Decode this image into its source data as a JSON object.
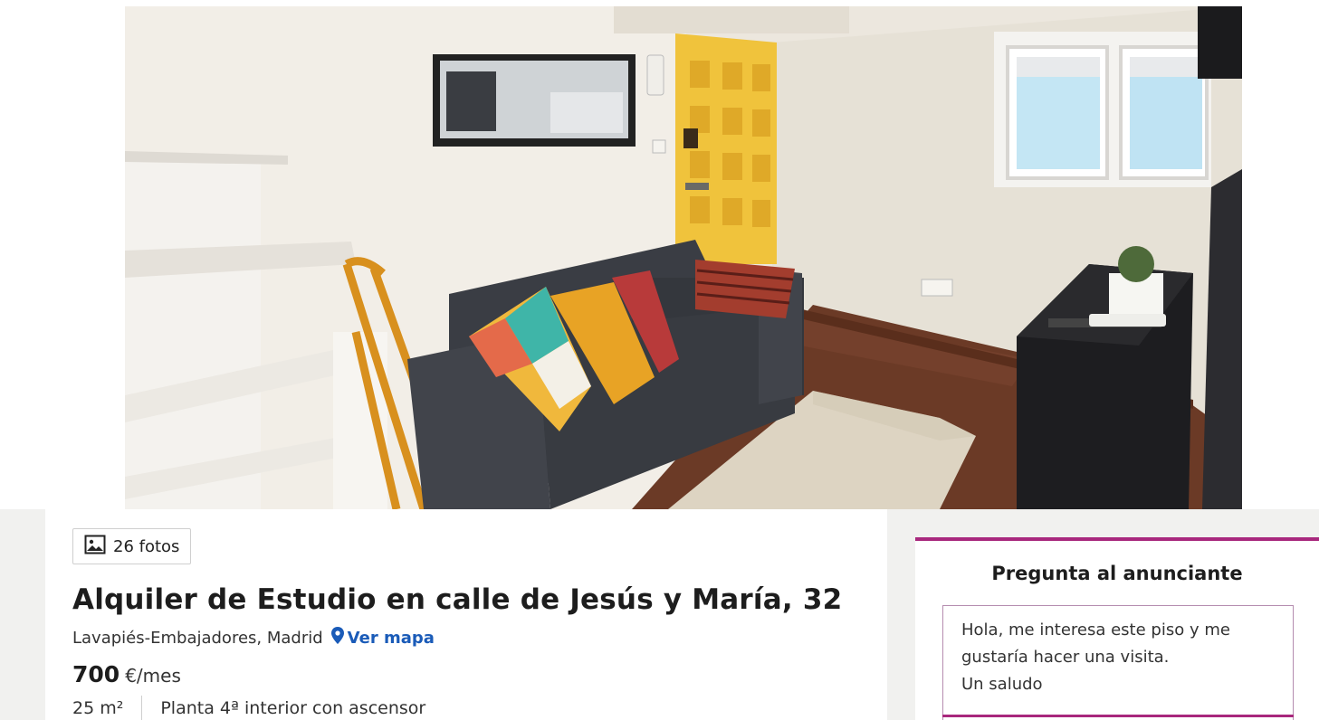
{
  "photos_button": {
    "icon": "image-icon",
    "label": "26 fotos"
  },
  "listing": {
    "title": "Alquiler de Estudio en calle de Jesús y María, 32",
    "location": "Lavapiés-Embajadores, Madrid",
    "map_link": {
      "icon": "map-pin-icon",
      "label": "Ver mapa"
    },
    "price": {
      "amount": "700",
      "unit": "€/mes"
    },
    "features": [
      "25 m²",
      "Planta 4ª interior con ascensor"
    ]
  },
  "contact": {
    "title": "Pregunta al anunciante",
    "message": "Hola, me interesa este piso y me\ngustaría hacer una visita.\nUn saludo"
  },
  "colors": {
    "accent": "#a8287d",
    "link": "#1a5bb8",
    "door": "#f0c33c",
    "sofa": "#3a3d44"
  }
}
